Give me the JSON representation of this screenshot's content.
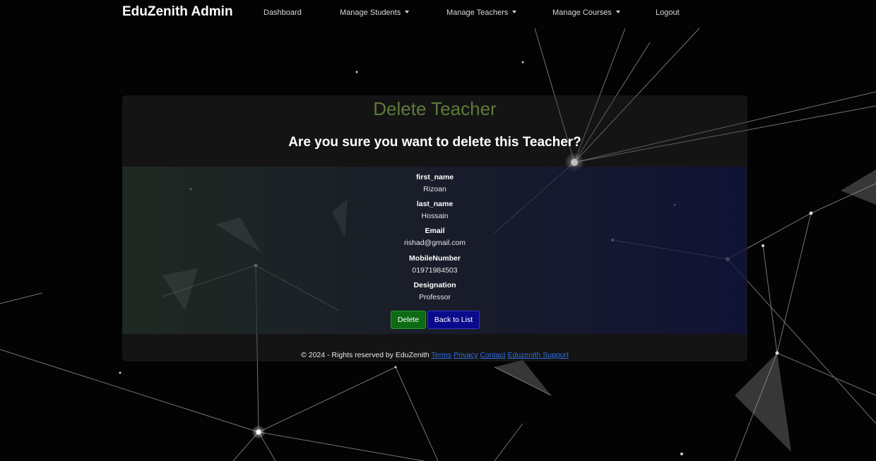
{
  "app": {
    "brand": "EduZenith Admin"
  },
  "nav": {
    "dashboard": "Dashboard",
    "manage_students": "Manage Students",
    "manage_teachers": "Manage Teachers",
    "manage_courses": "Manage Courses",
    "logout": "Logout"
  },
  "page": {
    "title": "Delete Teacher",
    "question": "Are you sure you want to delete this Teacher?"
  },
  "teacher": {
    "first_name": {
      "label": "first_name",
      "value": "Rizoan"
    },
    "last_name": {
      "label": "last_name",
      "value": "Hossain"
    },
    "email": {
      "label": "Email",
      "value": "rishad@gmail.com"
    },
    "mobile": {
      "label": "MobileNumber",
      "value": "01971984503"
    },
    "designation": {
      "label": "Designation",
      "value": "Professor"
    }
  },
  "actions": {
    "delete": "Delete",
    "back": "Back to List"
  },
  "footer": {
    "copyright": "© 2024 - Rights reserved by EduZenith",
    "links": {
      "terms": "Terms",
      "privacy": "Privacy",
      "contact": "Contact",
      "support": "Eduzenith Support"
    }
  },
  "colors": {
    "title": "#5f7a3a",
    "delete_button": "#0d6b14",
    "back_button": "#0a0a8c",
    "link": "#2f6ee0"
  }
}
